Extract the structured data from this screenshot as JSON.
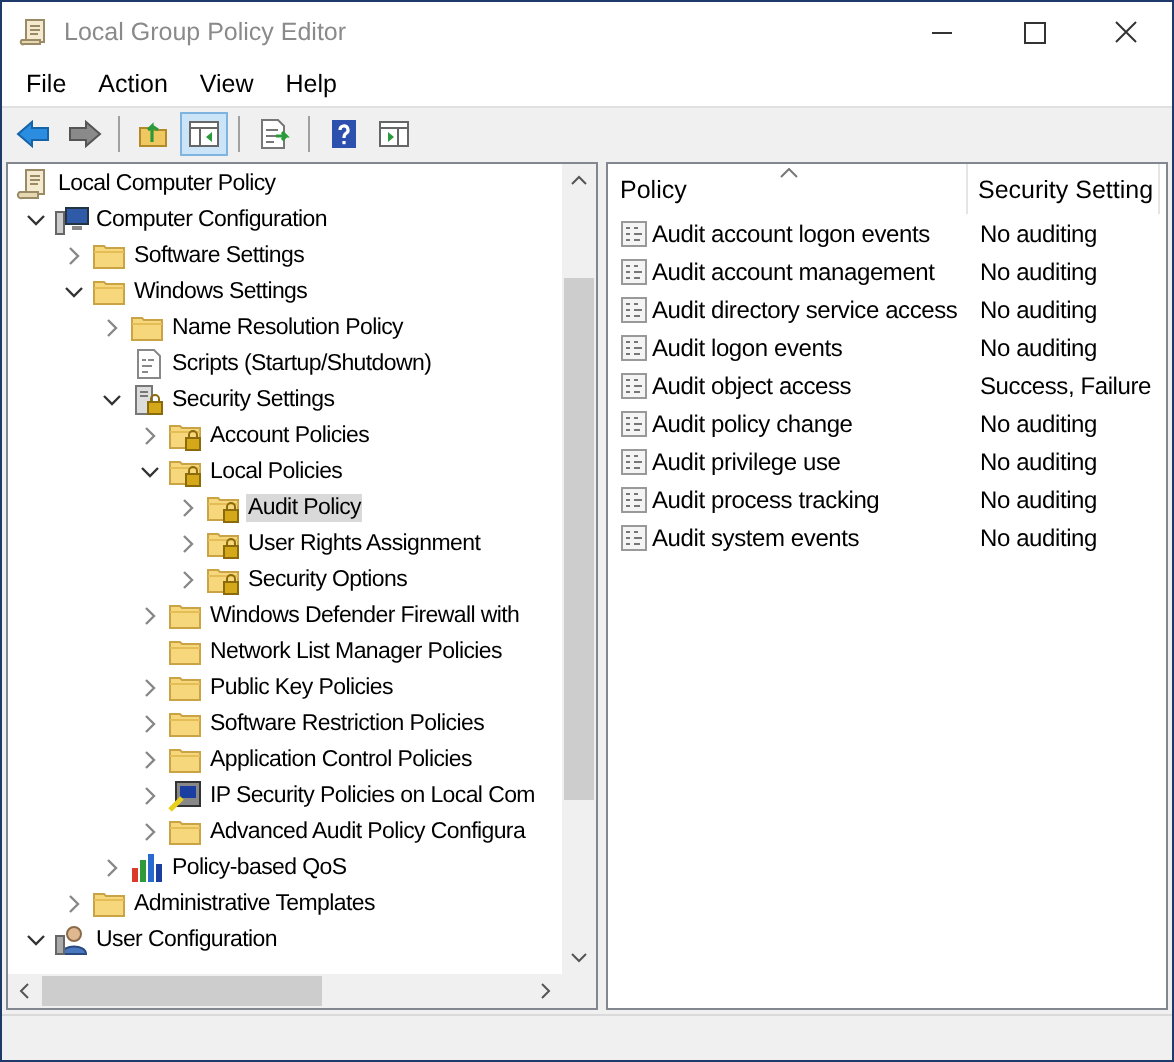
{
  "window": {
    "title": "Local Group Policy Editor"
  },
  "menu": [
    "File",
    "Action",
    "View",
    "Help"
  ],
  "toolbar": [
    {
      "kind": "back",
      "pressed": false
    },
    {
      "kind": "forward",
      "pressed": false
    },
    {
      "kind": "sep"
    },
    {
      "kind": "up",
      "pressed": false
    },
    {
      "kind": "tree",
      "pressed": true
    },
    {
      "kind": "sep"
    },
    {
      "kind": "export",
      "pressed": false
    },
    {
      "kind": "sep"
    },
    {
      "kind": "help",
      "pressed": false
    },
    {
      "kind": "pane",
      "pressed": false
    }
  ],
  "tree": [
    {
      "label": "Local Computer Policy",
      "kind": "scroll",
      "selected": false,
      "children": [
        {
          "label": "Computer Configuration",
          "kind": "computer",
          "expanded": true,
          "selected": false,
          "children": [
            {
              "label": "Software Settings",
              "kind": "folder",
              "expanded": false,
              "selected": false
            },
            {
              "label": "Windows Settings",
              "kind": "folder",
              "expanded": true,
              "selected": false,
              "children": [
                {
                  "label": "Name Resolution Policy",
                  "kind": "folder",
                  "expanded": false,
                  "selected": false
                },
                {
                  "label": "Scripts (Startup/Shutdown)",
                  "kind": "script",
                  "selected": false
                },
                {
                  "label": "Security Settings",
                  "kind": "security",
                  "expanded": true,
                  "selected": false,
                  "children": [
                    {
                      "label": "Account Policies",
                      "kind": "lockfolder",
                      "expanded": false,
                      "selected": false
                    },
                    {
                      "label": "Local Policies",
                      "kind": "lockfolder",
                      "expanded": true,
                      "selected": false,
                      "children": [
                        {
                          "label": "Audit Policy",
                          "kind": "lockfolder",
                          "expanded": false,
                          "selected": true
                        },
                        {
                          "label": "User Rights Assignment",
                          "kind": "lockfolder",
                          "expanded": false,
                          "selected": false
                        },
                        {
                          "label": "Security Options",
                          "kind": "lockfolder",
                          "expanded": false,
                          "selected": false
                        }
                      ]
                    },
                    {
                      "label": "Windows Defender Firewall with",
                      "kind": "folder",
                      "expanded": false,
                      "selected": false
                    },
                    {
                      "label": "Network List Manager Policies",
                      "kind": "folder",
                      "selected": false
                    },
                    {
                      "label": "Public Key Policies",
                      "kind": "folder",
                      "expanded": false,
                      "selected": false
                    },
                    {
                      "label": "Software Restriction Policies",
                      "kind": "folder",
                      "expanded": false,
                      "selected": false
                    },
                    {
                      "label": "Application Control Policies",
                      "kind": "folder",
                      "expanded": false,
                      "selected": false
                    },
                    {
                      "label": "IP Security Policies on Local Com",
                      "kind": "ipsec",
                      "expanded": false,
                      "selected": false
                    },
                    {
                      "label": "Advanced Audit Policy Configura",
                      "kind": "folder",
                      "expanded": false,
                      "selected": false
                    }
                  ]
                },
                {
                  "label": "Policy-based QoS",
                  "kind": "qos",
                  "expanded": false,
                  "selected": false
                }
              ]
            },
            {
              "label": "Administrative Templates",
              "kind": "folder",
              "expanded": false,
              "selected": false
            }
          ]
        },
        {
          "label": "User Configuration",
          "kind": "user",
          "expanded": true,
          "selected": false
        }
      ]
    }
  ],
  "table": {
    "columns": [
      "Policy",
      "Security Setting"
    ],
    "rows": [
      {
        "policy": "Audit account logon events",
        "setting": "No auditing"
      },
      {
        "policy": "Audit account management",
        "setting": "No auditing"
      },
      {
        "policy": "Audit directory service access",
        "setting": "No auditing"
      },
      {
        "policy": "Audit logon events",
        "setting": "No auditing"
      },
      {
        "policy": "Audit object access",
        "setting": "Success, Failure"
      },
      {
        "policy": "Audit policy change",
        "setting": "No auditing"
      },
      {
        "policy": "Audit privilege use",
        "setting": "No auditing"
      },
      {
        "policy": "Audit process tracking",
        "setting": "No auditing"
      },
      {
        "policy": "Audit system events",
        "setting": "No auditing"
      }
    ]
  }
}
